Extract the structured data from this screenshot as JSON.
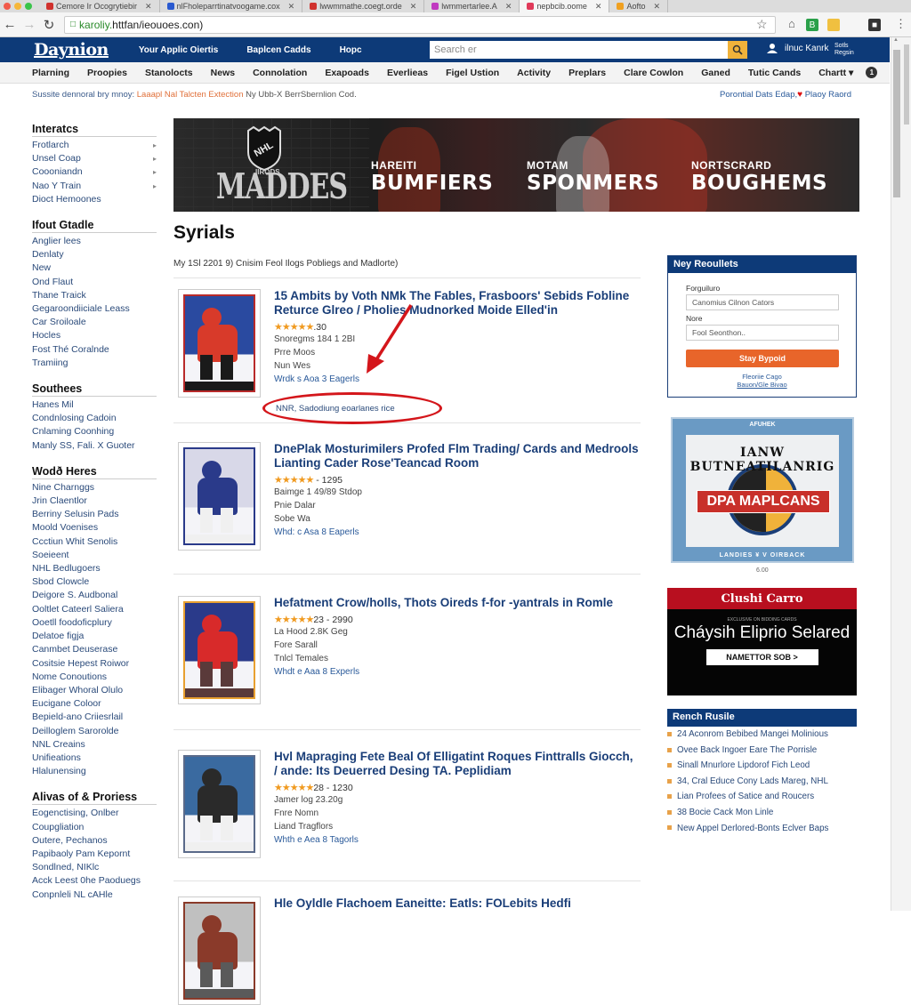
{
  "browser": {
    "tabs": [
      {
        "label": "Cemore Ir Ocogrytiebir",
        "active": false,
        "color": "#d0312d"
      },
      {
        "label": "nlFholeparrtinatvoogame.cox",
        "active": false,
        "color": "#2a5ad0"
      },
      {
        "label": "lwwmmathe.coegt.orde",
        "active": false,
        "color": "#d0312d"
      },
      {
        "label": "lwmmertarlee.A",
        "active": false,
        "color": "#c03ac0"
      },
      {
        "label": "nepbcib.oome",
        "active": true,
        "color": "#e03a5a"
      },
      {
        "label": "Aofto",
        "active": false,
        "color": "#f0a020"
      }
    ],
    "url_prefix": "karoliy.",
    "url": "httfan/ieouoes.con)",
    "extensions": [
      "home-icon",
      "B",
      "bookmark",
      "-",
      "extension"
    ]
  },
  "site": {
    "logo": "Daynion",
    "top_links": [
      "Your Applic Oiertis",
      "Baplcen Cadds",
      "Hopc"
    ],
    "search_placeholder": "Search er",
    "user_name": "ilnuc Kanrk",
    "sign_in": "Sotls Regsin"
  },
  "nav": {
    "items": [
      "Plarning",
      "Proopies",
      "Stanolocts",
      "News",
      "Connolation",
      "Exapoads",
      "Everlieas",
      "Figel Ustion",
      "Activity",
      "Preplars",
      "Clare Cowlon",
      "Ganed",
      "Tutic Cands",
      "Chartt ▾"
    ],
    "badge": "1"
  },
  "ticker": {
    "lead": "Sussite dennoral bry mnoy:",
    "highlight": "Laaapl Nal Talcten Extection",
    "rest": "Ny Ubb-X BerrSbernlion Cod.",
    "right": "Porontial Dats Edap,",
    "right_link": "Plaoy Raord"
  },
  "sidebar": [
    {
      "title": "Interatcs",
      "items": [
        {
          "label": "Frotlarch",
          "chevron": true
        },
        {
          "label": "Unsel Coap",
          "chevron": true
        },
        {
          "label": "Coooniandn",
          "chevron": true
        },
        {
          "label": "Nao Y Train",
          "chevron": true
        },
        {
          "label": "Dioct Hemoones",
          "chevron": false
        }
      ]
    },
    {
      "title": "Ifout Gtadle",
      "items": [
        {
          "label": "Anglier lees"
        },
        {
          "label": "Denlaty"
        },
        {
          "label": "New"
        },
        {
          "label": "Ond Flaut"
        },
        {
          "label": "Thane Traick"
        },
        {
          "label": "Gegaroondiiciale Leass"
        },
        {
          "label": "Car Sroiloale"
        },
        {
          "label": "Hocles"
        },
        {
          "label": "Fost Thé Coralnde"
        },
        {
          "label": "Tramiing"
        }
      ]
    },
    {
      "title": "Southees",
      "items": [
        {
          "label": "Hanes Mil"
        },
        {
          "label": "Condnlosing Cadoin"
        },
        {
          "label": "Cnlaming Coonhing"
        },
        {
          "label": "Manly SS, Fali. X Guoter"
        }
      ]
    },
    {
      "title": "Wodð Heres",
      "items": [
        {
          "label": "Nine Charnggs"
        },
        {
          "label": "Jrin Claentlor"
        },
        {
          "label": "Berriny Selusin Pads"
        },
        {
          "label": "Moold Voenises"
        },
        {
          "label": "Ccctiun Whit Senolis"
        },
        {
          "label": "Soeieent"
        },
        {
          "label": "NHL Bedlugoers"
        },
        {
          "label": "Sbod Clowcle"
        },
        {
          "label": "Deigore S. Audbonal"
        },
        {
          "label": "Ooltlet Cateerl Saliera"
        },
        {
          "label": "Ooetll foodoficplury"
        },
        {
          "label": "Delatoe figja"
        },
        {
          "label": "Canmbet Deuserase"
        },
        {
          "label": "Cositsie Hepest Roiwor"
        },
        {
          "label": "Nome Conoutions"
        },
        {
          "label": "Elibager Whoral Olulo"
        },
        {
          "label": "Eucigane Coloor"
        },
        {
          "label": "Bepield-ano Criiesrlail"
        },
        {
          "label": "Deilloglem Sarorolde"
        },
        {
          "label": "NNL Creains"
        },
        {
          "label": "Unifieations"
        },
        {
          "label": "Hlalunensing"
        }
      ]
    },
    {
      "title": "Alivas of & Proriess",
      "items": [
        {
          "label": "Eogenctising, Onlber"
        },
        {
          "label": "Coupgliation"
        },
        {
          "label": "Outere, Pechanos"
        },
        {
          "label": "Papibaoly Pam Kepornt"
        },
        {
          "label": "Sondlned, NIKlc"
        },
        {
          "label": "Acck Leest 0he Paoduegs"
        },
        {
          "label": "Conpnleli NL cAHle"
        }
      ]
    }
  ],
  "banner": {
    "logo_text": "MADDES",
    "logo_small": "IIRODS",
    "teams": [
      {
        "small": "HAREITI",
        "big": "BUMFIERS"
      },
      {
        "small": "MOTAM",
        "big": "SPONMERS"
      },
      {
        "small": "NORTSCRARD",
        "big": "BOUGHEMS"
      }
    ]
  },
  "main": {
    "title": "Syrials",
    "dateline": "My 1Sl 2201 9) Cnisim Feol Ilogs Pobliegs and Madlorte)",
    "articles": [
      {
        "title": "15 Ambits by Voth NMk The Fables, Frasboors' Sebids Fobline Returce Glreo / Pholies Mudnorked Moide Elled'in",
        "stars": "★★★★★",
        "rating": ".30",
        "meta": [
          "Snoregms 184 1 2BI",
          "Prre Moos",
          "Nun Wes"
        ],
        "more": "Wrdk s Aoa 3 Eagerls",
        "card_colors": [
          "#b82a2a",
          "#1a1a1a",
          "#d83a2a",
          "#2a4aa0"
        ]
      },
      {
        "title": "DnePlak Mosturimilers Profed Flm Trading/ Cards and Medrools Lianting Cader Rose'Teancad Room",
        "stars": "★★★★★",
        "rating": " - 1295",
        "meta": [
          "Baimge 1 49/89 Stdop",
          "Pnie Dalar",
          "Sobe Wa"
        ],
        "more": "Whd: c Asa 8 Eaperls",
        "card_colors": [
          "#2a3a8a",
          "#f0f0f0",
          "#2a3a8a",
          "#d8d8e8"
        ]
      },
      {
        "title": "Hefatment Crow/holls, Thots Oireds f-for -yantrals in Romle",
        "stars": "★★★★★",
        "rating": "23 - 2990",
        "meta": [
          "La Hood 2.8K Geg",
          "Fore Sarall",
          "Tnlcl Temales"
        ],
        "more": "Whdt e Aaa 8 Experls",
        "card_colors": [
          "#e8a030",
          "#5a3a3a",
          "#d82a2a",
          "#2a3a8a"
        ]
      },
      {
        "title": "Hvl Mapraging Fete Beal Of Elligatint Roques Finttralls Giocch, / ande: Its Deuerred Desing TA. Peplidiam",
        "stars": "★★★★★",
        "rating": "28 - 1230",
        "meta": [
          "Jamer log 23.20g",
          "Fnre Nomn",
          "Liand Tragflors"
        ],
        "more": "Whth e Aea 8 Tagorls",
        "card_colors": [
          "#5a6a8a",
          "#f0f0f0",
          "#2a2a2a",
          "#3a6aa0"
        ]
      },
      {
        "title": "Hle Oyldle Flachoem Eaneitte: Eatls: FOLebits Hedfi",
        "stars": "",
        "rating": "",
        "meta": [],
        "more": "",
        "card_colors": [
          "#8a3a2a",
          "#5a5a5a",
          "#8a3a2a",
          "#c0c0c0"
        ]
      }
    ],
    "annotation_text": "NNR, Sadodiung eoarlanes rice"
  },
  "newsletter": {
    "title": "Ney Reoullets",
    "label1": "Forguiluro",
    "input1": "Canomius Cilnon Cators",
    "label2": "Nore",
    "input2_placeholder": "Fool Seonthon..",
    "button": "Stay Bypoid",
    "foot1": "Fleoriie Cago",
    "foot2": "Bauon/Gle Bivao"
  },
  "ad": {
    "top": "AFUHEK",
    "arc": "IANW BUTNEATILANRIG",
    "ribbon": "DPA MAPLCANS",
    "bottom": "LANDIES ¥ V OIRBACK",
    "caption": "6.00"
  },
  "promo": {
    "head": "Clushi Carro",
    "sub": "EXCLUSIVE ON BIDDING CARDS",
    "big": "Cháysih Eliprio Selared",
    "button": "NAMETTOR SOB  >"
  },
  "related": {
    "title": "Rench Rusile",
    "items": [
      "24 Aconrom Bebibed Mangei Molinious",
      "Ovee Back Ingoer Eare The Porrisle",
      "Sinall Mnurlore Lipdorof Fich Leod",
      "34, Cral Educe Cony Lads Mareg, NHL",
      "Lian Profees of Satice and Roucers",
      "38 Bocie Cack Mon Linle",
      "New Appel Derlored-Bonts Eclver Baps"
    ]
  },
  "colors": {
    "brand_navy": "#0d3a78",
    "link_blue": "#1a3e78",
    "accent_orange": "#e8652a",
    "search_yellow": "#f0b23a",
    "annotation_red": "#d4161b",
    "promo_red": "#b80f1f"
  }
}
